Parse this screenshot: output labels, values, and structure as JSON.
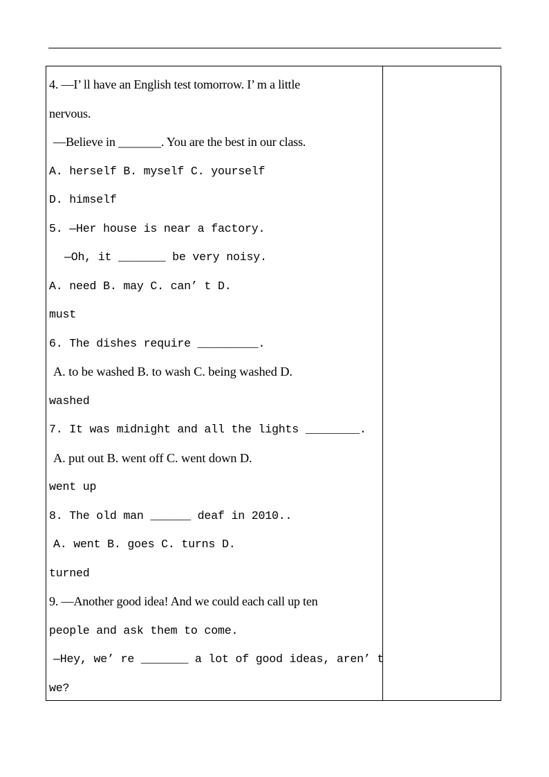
{
  "document": {
    "type": "english-grammar-worksheet",
    "header_rule": true,
    "table": {
      "columns": 2,
      "main_column_label": "questions",
      "side_column_label": "answer-notes-blank",
      "side_column_content": ""
    }
  },
  "questions": [
    {
      "number": "4.",
      "lines": [
        {
          "id": "q4l1",
          "style": "mix",
          "indent": 0,
          "text": "4. —I’ ll have an English test tomorrow. I’ m a little"
        },
        {
          "id": "q4l2",
          "style": "mix",
          "indent": 0,
          "text": "nervous."
        },
        {
          "id": "q4l3",
          "style": "mix",
          "indent": 1,
          "text": "—Believe in _______. You are the best in our class."
        },
        {
          "id": "q4o1",
          "style": "mono",
          "indent": 0,
          "text": "A.  herself        B.  myself        C.  yourself"
        },
        {
          "id": "q4o2",
          "style": "mono",
          "indent": 0,
          "text": "D.  himself"
        }
      ]
    },
    {
      "number": "5.",
      "lines": [
        {
          "id": "q5l1",
          "style": "mono",
          "indent": 0,
          "text": "5. —Her house is near a factory."
        },
        {
          "id": "q5l2",
          "style": "mono",
          "indent": 1,
          "text": "—Oh, it _______ be very noisy."
        },
        {
          "id": "q5o1",
          "style": "mono",
          "indent": 0,
          "text": "A. need          B. may       C. can’ t         D."
        },
        {
          "id": "q5o2",
          "style": "mono",
          "indent": 0,
          "text": "must"
        }
      ]
    },
    {
      "number": "6.",
      "lines": [
        {
          "id": "q6l1",
          "style": "mono",
          "indent": 0,
          "text": "6.  The dishes require _________."
        },
        {
          "id": "q6o1",
          "style": "serif",
          "indent": 1,
          "text": "A. to be washed   B. to wash    C. being washed    D."
        },
        {
          "id": "q6o2",
          "style": "mono",
          "indent": 0,
          "text": "washed"
        }
      ]
    },
    {
      "number": "7.",
      "lines": [
        {
          "id": "q7l1",
          "style": "mono",
          "indent": 0,
          "text": "7.  It was midnight and all the lights ________."
        },
        {
          "id": "q7o1",
          "style": "serif",
          "indent": 1,
          "text": "A. put out        B. went off    C. went down        D."
        },
        {
          "id": "q7o2",
          "style": "mono",
          "indent": 0,
          "text": "went up"
        }
      ]
    },
    {
      "number": "8.",
      "lines": [
        {
          "id": "q8l1",
          "style": "mono",
          "indent": 0,
          "text": "8.  The old man ______ deaf in 2010.."
        },
        {
          "id": "q8o1",
          "style": "mono",
          "indent": 1,
          "text": "A.  went        B.  goes     C.  turns        D."
        },
        {
          "id": "q8o2",
          "style": "mono",
          "indent": 0,
          "text": "turned"
        }
      ]
    },
    {
      "number": "9.",
      "lines": [
        {
          "id": "q9l1",
          "style": "mix",
          "indent": 0,
          "text": "9. —Another good idea! And we could each call up ten"
        },
        {
          "id": "q9l2",
          "style": "mono",
          "indent": 0,
          "text": "people and ask them to come."
        },
        {
          "id": "q9l3",
          "style": "mono",
          "indent": 1,
          "text": "—Hey, we’ re _______ a lot of good ideas, aren’ t"
        },
        {
          "id": "q9l4",
          "style": "mono",
          "indent": 0,
          "text": "we?"
        }
      ]
    }
  ],
  "colors": {
    "text": "#000000",
    "rule": "#000000",
    "background": "#ffffff"
  }
}
